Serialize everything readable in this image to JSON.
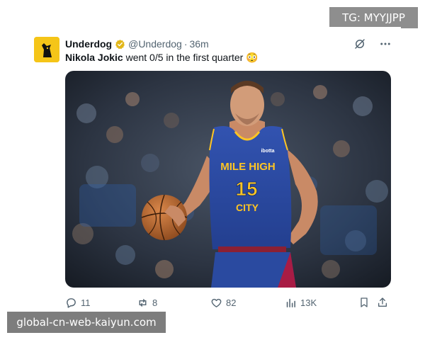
{
  "overlay": {
    "tg_badge": "TG: MYYJJPP",
    "watermark": "global-cn-web-kaiyun.com"
  },
  "tweet": {
    "author": {
      "display_name": "Underdog",
      "handle": "@Underdog",
      "verified": true,
      "avatar_icon": "dog-logo-icon",
      "avatar_color": "#f5c518"
    },
    "separator": "·",
    "time": "36m",
    "text_player": "Nikola Jokic",
    "text_rest": " went 0/5 in the first quarter 😳",
    "media": {
      "jersey_text_top": "MILE HIGH",
      "jersey_number": "15",
      "jersey_text_bottom": "CITY",
      "sponsor": "ibotta",
      "jersey_color": "#2c4a9e",
      "jersey_trim": "#fec524"
    },
    "actions": {
      "replies": "11",
      "reposts": "8",
      "likes": "82",
      "views": "13K"
    }
  }
}
